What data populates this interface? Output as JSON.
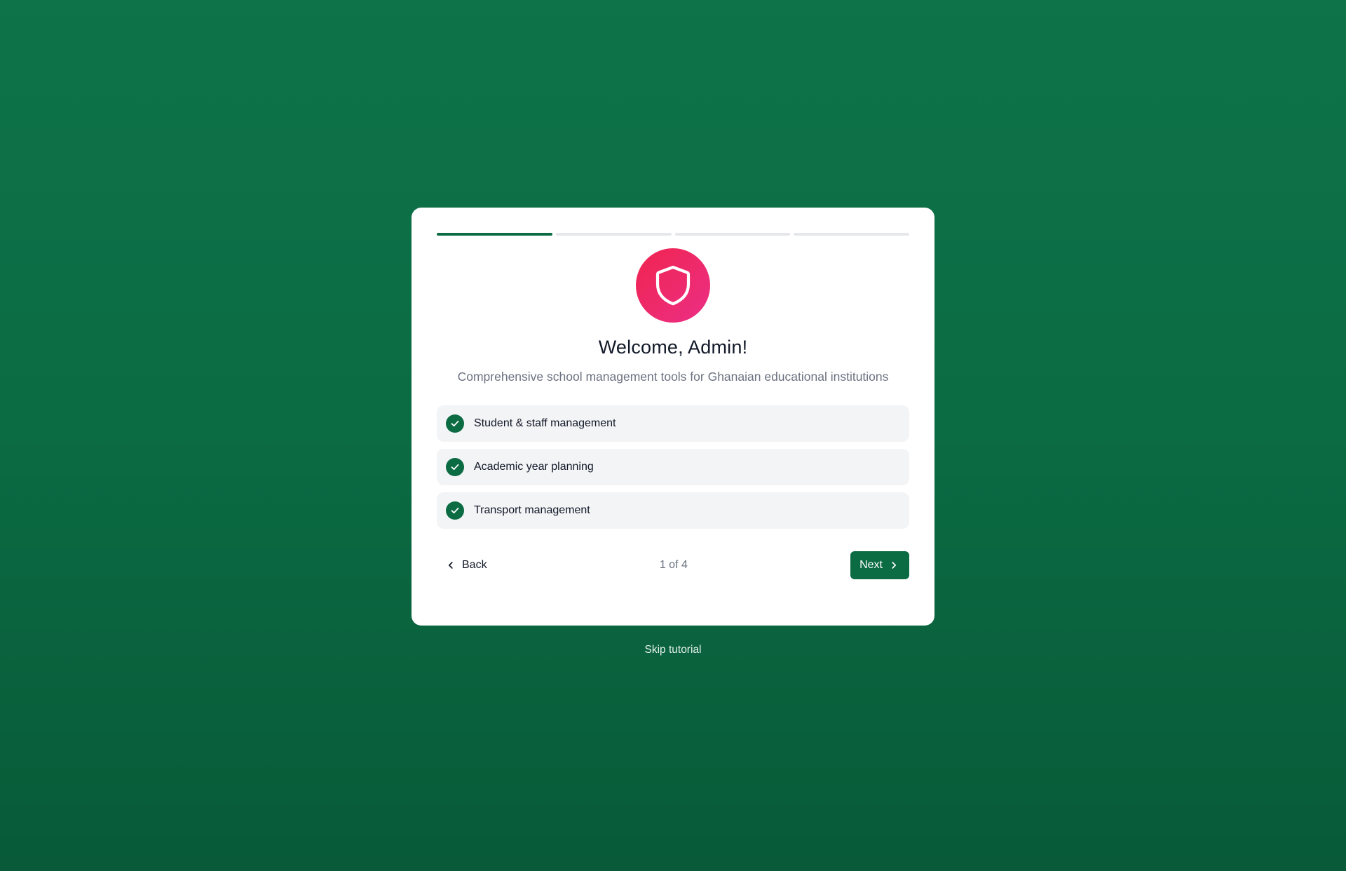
{
  "progress": {
    "total_steps": 4,
    "current_step": 1
  },
  "hero": {
    "icon": "shield-icon",
    "title": "Welcome, Admin!",
    "subtitle": "Comprehensive school management tools for Ghanaian educational institutions"
  },
  "features": [
    {
      "label": "Student & staff management",
      "icon": "check-icon"
    },
    {
      "label": "Academic year planning",
      "icon": "check-icon"
    },
    {
      "label": "Transport management",
      "icon": "check-icon"
    }
  ],
  "nav": {
    "back_label": "Back",
    "step_text": "1 of 4",
    "next_label": "Next"
  },
  "skip_label": "Skip tutorial",
  "colors": {
    "brand": "#0b6b43",
    "background": "#0b6b43",
    "hero_gradient_start": "#f0244f",
    "hero_gradient_end": "#ec2f86"
  }
}
